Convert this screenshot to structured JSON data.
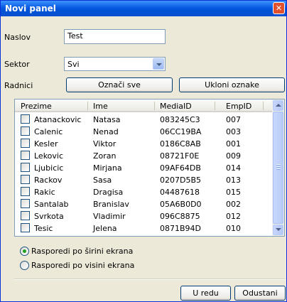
{
  "window": {
    "title": "Novi panel",
    "close_glyph": "✕"
  },
  "form": {
    "naslov_label": "Naslov",
    "naslov_value": "Test",
    "sektor_label": "Sektor",
    "sektor_value": "Svi",
    "radnici_label": "Radnici",
    "oznaci_label": "Označi sve",
    "ukloni_label": "Ukloni oznake"
  },
  "table": {
    "headers": [
      "Prezime",
      "Ime",
      "MediaID",
      "EmpID"
    ],
    "rows": [
      {
        "prezime": "Atanackovic",
        "ime": "Natasa",
        "media": "083245C3",
        "emp": "007",
        "checked": false
      },
      {
        "prezime": "Calenic",
        "ime": "Nenad",
        "media": "06CC19BA",
        "emp": "003",
        "checked": false
      },
      {
        "prezime": "Kesler",
        "ime": "Viktor",
        "media": "0186C8AB",
        "emp": "001",
        "checked": false
      },
      {
        "prezime": "Lekovic",
        "ime": "Zoran",
        "media": "08721F0E",
        "emp": "009",
        "checked": false
      },
      {
        "prezime": "Ljubicic",
        "ime": "Mirjana",
        "media": "09AF64DB",
        "emp": "014",
        "checked": false
      },
      {
        "prezime": "Rackov",
        "ime": "Sasa",
        "media": "0207D5B5",
        "emp": "013",
        "checked": false
      },
      {
        "prezime": "Rakic",
        "ime": "Dragisa",
        "media": "04487618",
        "emp": "015",
        "checked": false
      },
      {
        "prezime": "Santalab",
        "ime": "Branislav",
        "media": "05A6B0D0",
        "emp": "002",
        "checked": false
      },
      {
        "prezime": "Svrkota",
        "ime": "Vladimir",
        "media": "096C8875",
        "emp": "012",
        "checked": false
      },
      {
        "prezime": "Tesic",
        "ime": "Jelena",
        "media": "0871B94D",
        "emp": "010",
        "checked": false
      }
    ]
  },
  "layout_options": {
    "option1": "Rasporedi po širini ekrana",
    "option2": "Rasporedi po visini ekrana",
    "selected": 1
  },
  "footer": {
    "ok_label": "U redu",
    "cancel_label": "Odustani"
  },
  "colors": {
    "titlebar": "#0a5ae1",
    "dialog_bg": "#ece9d8",
    "radio_dot": "#21a121"
  }
}
